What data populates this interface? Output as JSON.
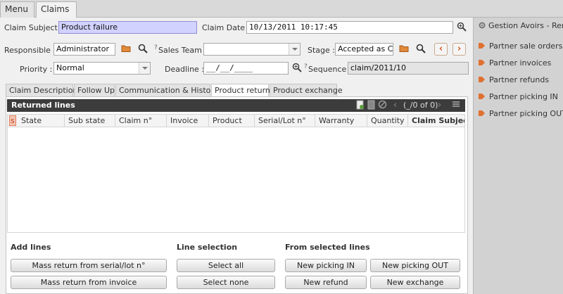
{
  "tabs": [
    {
      "label": "Menu",
      "close": "✖"
    },
    {
      "label": "Claims",
      "close": "✖"
    }
  ],
  "form": {
    "claim_subject_label": "Claim Subject :",
    "claim_subject_value": "Product failure",
    "claim_date_label": "Claim Date :",
    "claim_date_value": "10/13/2011 10:17:45",
    "responsible_label": "Responsible :",
    "responsible_value": "Administrator",
    "sales_team_mark": "?",
    "sales_team_label": "Sales Team :",
    "sales_team_value": "",
    "stage_label": "Stage :",
    "stage_value": "Accepted as Cla",
    "priority_label": "Priority :",
    "priority_value": "Normal",
    "deadline_label": "Deadline :",
    "deadline_value": "__/__/____",
    "sequence_mark": "?",
    "sequence_label": "Sequence :",
    "sequence_value": "claim/2011/10",
    "prev_label": "‹",
    "next_label": "›"
  },
  "notebook": {
    "tabs": [
      "Claim Description",
      "Follow Up",
      "Communication & History",
      "Product return",
      "Product exchange"
    ],
    "active": "Product return"
  },
  "grid": {
    "title": "Returned lines",
    "pager": "(_/0 of 0)",
    "columns": [
      "s",
      "State",
      "Sub state",
      "Claim n°",
      "Invoice",
      "Product",
      "Serial/Lot n°",
      "Warranty",
      "Quantity",
      "Claim Subject"
    ]
  },
  "actions": {
    "add_lines_title": "Add lines",
    "mass_serial": "Mass return from serial/lot n°",
    "mass_invoice": "Mass return from invoice",
    "line_selection_title": "Line selection",
    "select_all": "Select all",
    "select_none": "Select none",
    "from_selected_title": "From selected lines",
    "new_picking_in": "New picking IN",
    "new_picking_out": "New picking OUT",
    "new_refund": "New refund",
    "new_exchange": "New exchange"
  },
  "sidebar": {
    "header": "Gestion Avoirs - Remb",
    "items": [
      "Partner sale orders",
      "Partner invoices",
      "Partner refunds",
      "Partner picking IN",
      "Partner picking OUT"
    ]
  },
  "colors": {
    "required_field": "#d2d2ff",
    "grid_header": "#3c3c3c",
    "nav_accent": "#d9531e"
  }
}
